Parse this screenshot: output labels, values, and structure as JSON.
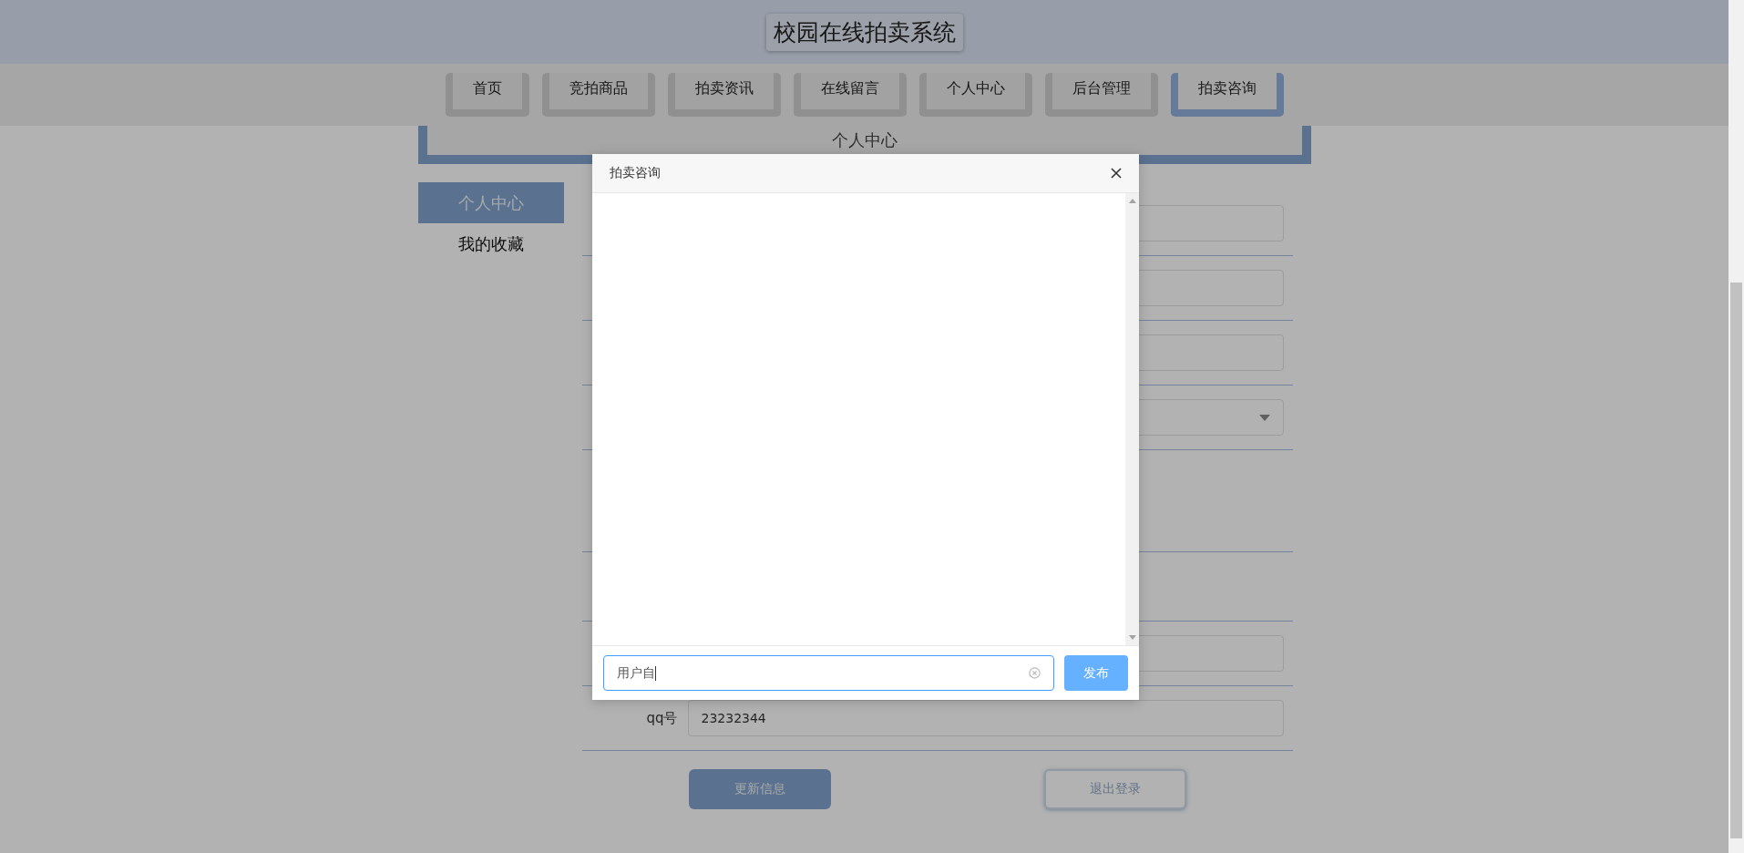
{
  "header": {
    "title": "校园在线拍卖系统"
  },
  "nav": [
    {
      "label": "首页",
      "selected": false
    },
    {
      "label": "竞拍商品",
      "selected": false
    },
    {
      "label": "拍卖资讯",
      "selected": false
    },
    {
      "label": "在线留言",
      "selected": false
    },
    {
      "label": "个人中心",
      "selected": false
    },
    {
      "label": "后台管理",
      "selected": false
    },
    {
      "label": "拍卖咨询",
      "selected": true
    }
  ],
  "page_card": {
    "title": "个人中心"
  },
  "sidebar": [
    {
      "label": "个人中心",
      "selected": true
    },
    {
      "label": "我的收藏",
      "selected": false
    }
  ],
  "form": {
    "rows": [
      {
        "kind": "input"
      },
      {
        "kind": "input"
      },
      {
        "kind": "input"
      },
      {
        "kind": "select"
      },
      {
        "kind": "tall_blank"
      },
      {
        "kind": "blank"
      },
      {
        "kind": "input"
      },
      {
        "kind": "input",
        "label": "qq号",
        "value": "23232344"
      }
    ]
  },
  "buttons": [
    {
      "label": "更新信息",
      "kind": "primary"
    },
    {
      "label": "退出登录",
      "kind": "outline"
    }
  ],
  "dialog": {
    "title": "拍卖咨询",
    "message": {
      "value": "用户自"
    },
    "send_button": "发布"
  }
}
